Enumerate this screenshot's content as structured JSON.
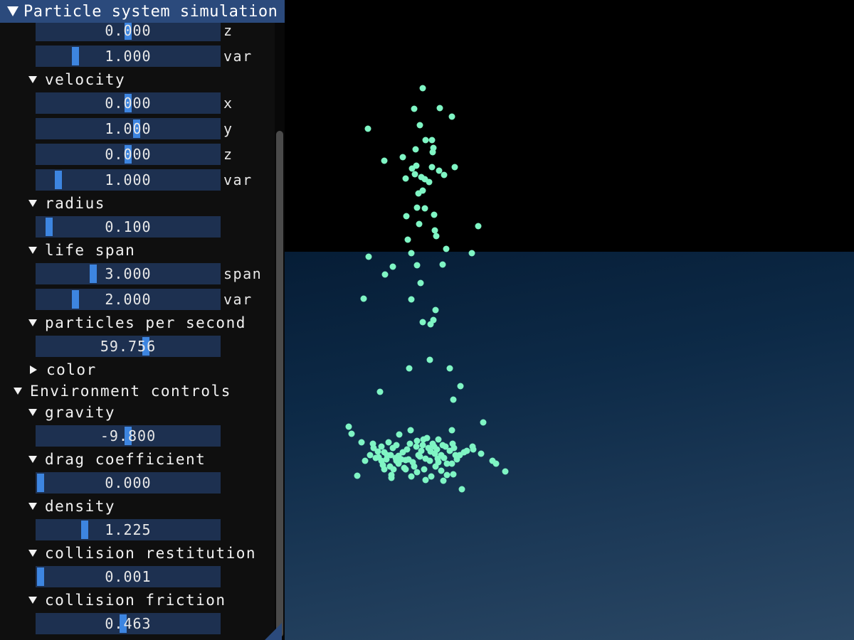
{
  "window": {
    "title": "Particle system simulation",
    "accent_color": "#2b4a7c",
    "slider_bg_color": "#1d3050",
    "grab_color": "#3d85e0"
  },
  "panel": {
    "emitter_rows": [
      {
        "value": "0.000",
        "suffix": "z",
        "grab": 0.5
      },
      {
        "value": "1.000",
        "suffix": "var",
        "grab": 0.2
      }
    ],
    "velocity": {
      "label": "velocity",
      "rows": [
        {
          "value": "0.000",
          "suffix": "x",
          "grab": 0.5
        },
        {
          "value": "1.000",
          "suffix": "y",
          "grab": 0.55
        },
        {
          "value": "0.000",
          "suffix": "z",
          "grab": 0.5
        },
        {
          "value": "1.000",
          "suffix": "var",
          "grab": 0.1
        }
      ]
    },
    "radius": {
      "label": "radius",
      "rows": [
        {
          "value": "0.100",
          "suffix": "",
          "grab": 0.05
        }
      ]
    },
    "life_span": {
      "label": "life span",
      "rows": [
        {
          "value": "3.000",
          "suffix": "span",
          "grab": 0.3
        },
        {
          "value": "2.000",
          "suffix": "var",
          "grab": 0.2
        }
      ]
    },
    "particles_per_second": {
      "label": "particles per second",
      "rows": [
        {
          "value": "59.756",
          "suffix": "",
          "grab": 0.6
        }
      ]
    },
    "color": {
      "label": "color"
    },
    "environment": {
      "label": "Environment controls",
      "gravity": {
        "label": "gravity",
        "rows": [
          {
            "value": "-9.800",
            "suffix": "",
            "grab": 0.5
          }
        ]
      },
      "drag": {
        "label": "drag coefficient",
        "rows": [
          {
            "value": "0.000",
            "suffix": "",
            "grab": 0.0
          }
        ]
      },
      "density": {
        "label": "density",
        "rows": [
          {
            "value": "1.225",
            "suffix": "",
            "grab": 0.25
          }
        ]
      },
      "restitution": {
        "label": "collision restitution",
        "rows": [
          {
            "value": "0.001",
            "suffix": "",
            "grab": 0.0
          }
        ]
      },
      "friction": {
        "label": "collision friction",
        "rows": [
          {
            "value": "0.463",
            "suffix": "",
            "grab": 0.47
          }
        ]
      }
    }
  },
  "scene": {
    "sky_color": "#000000",
    "ground_color_near": "#2b4865",
    "ground_color_far": "#061d36",
    "particle_color": "#7ff5c4"
  }
}
